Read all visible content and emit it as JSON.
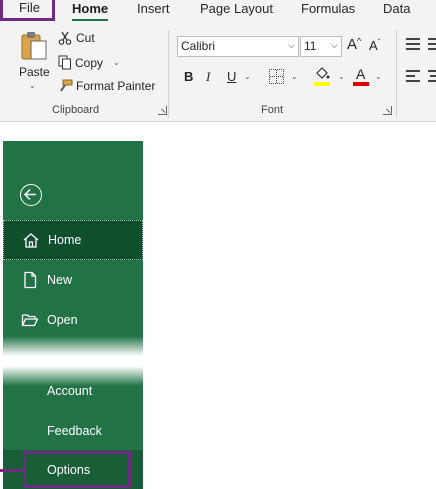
{
  "tabs": {
    "file": "File",
    "home": "Home",
    "insert": "Insert",
    "page_layout": "Page Layout",
    "formulas": "Formulas",
    "data": "Data"
  },
  "clipboard": {
    "paste": "Paste",
    "cut": "Cut",
    "copy": "Copy",
    "format_painter": "Format Painter",
    "group_label": "Clipboard"
  },
  "font": {
    "font_name": "Calibri",
    "font_size": "11",
    "bold": "B",
    "italic": "I",
    "underline": "U",
    "group_label": "Font",
    "highlight_color": "#ffff00",
    "font_color": "#e00000"
  },
  "backstage": {
    "items": [
      {
        "label": "Home"
      },
      {
        "label": "New"
      },
      {
        "label": "Open"
      },
      {
        "label": "Account"
      },
      {
        "label": "Feedback"
      },
      {
        "label": "Options"
      }
    ],
    "accent": "#217346",
    "highlight": "#6f2a82"
  }
}
